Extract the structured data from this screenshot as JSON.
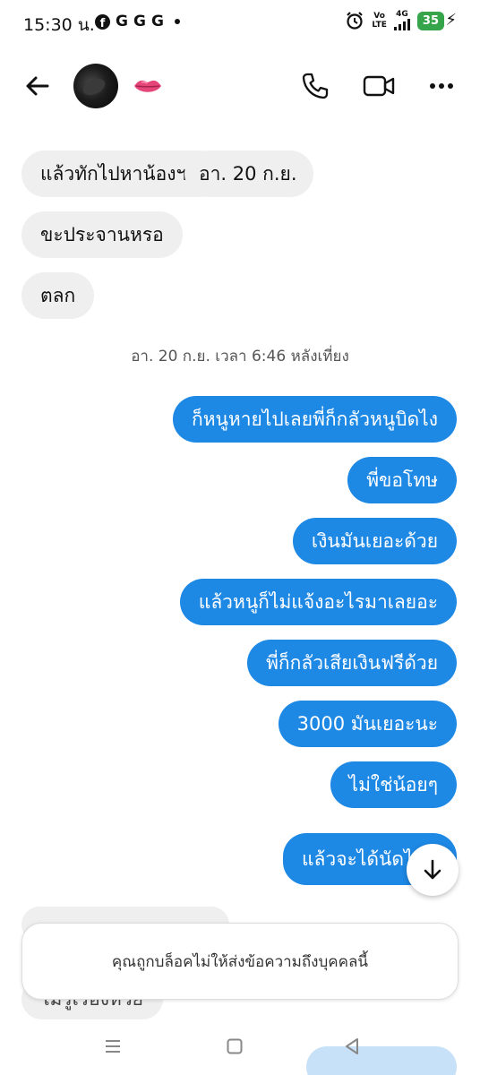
{
  "status_bar": {
    "time": "15:30 น.",
    "apps": [
      "G",
      "G",
      "G"
    ],
    "volte_line1": "Vo",
    "volte_line2": "LTE",
    "network": "4G",
    "battery": "35"
  },
  "header": {
    "contact_emoji": "lips-emoji",
    "icons": [
      "back-arrow-icon",
      "phone-icon",
      "video-camera-icon",
      "more-icon"
    ]
  },
  "messages": {
    "incoming": [
      "แล้วทักไปหาน้องฯ",
      "ขะประจานหรอ",
      "ตลก"
    ],
    "overlay_timestamp": "อา. 20 ก.ย.",
    "separator": "อา. 20 ก.ย. เวลา 6:46 หลังเที่ยง",
    "outgoing": [
      "ก็หนูหายไปเลยพี่ก็กลัวหนูบิดไง",
      "พี่ขอโทษ",
      "เงินมันเยอะด้วย",
      "แล้วหนูก็ไม่แจ้งอะไรมาเลยอะ",
      "พี่ก็กลัวเสียเงินฟรีด้วย",
      "3000 มันเยอะนะ",
      "ไม่ใช่น้อยๆ",
      "แล้วจะได้นัดไ"
    ],
    "partial_incoming_bottom": "ไม่รู้เรื่องหวย"
  },
  "blocked_notice": "คุณถูกบล็อคไม่ให้ส่งข้อความถึงบุคคลนี้",
  "colors": {
    "outgoing_bubble": "#1e88e5",
    "incoming_bubble": "#efefef",
    "battery": "#35a44a"
  }
}
